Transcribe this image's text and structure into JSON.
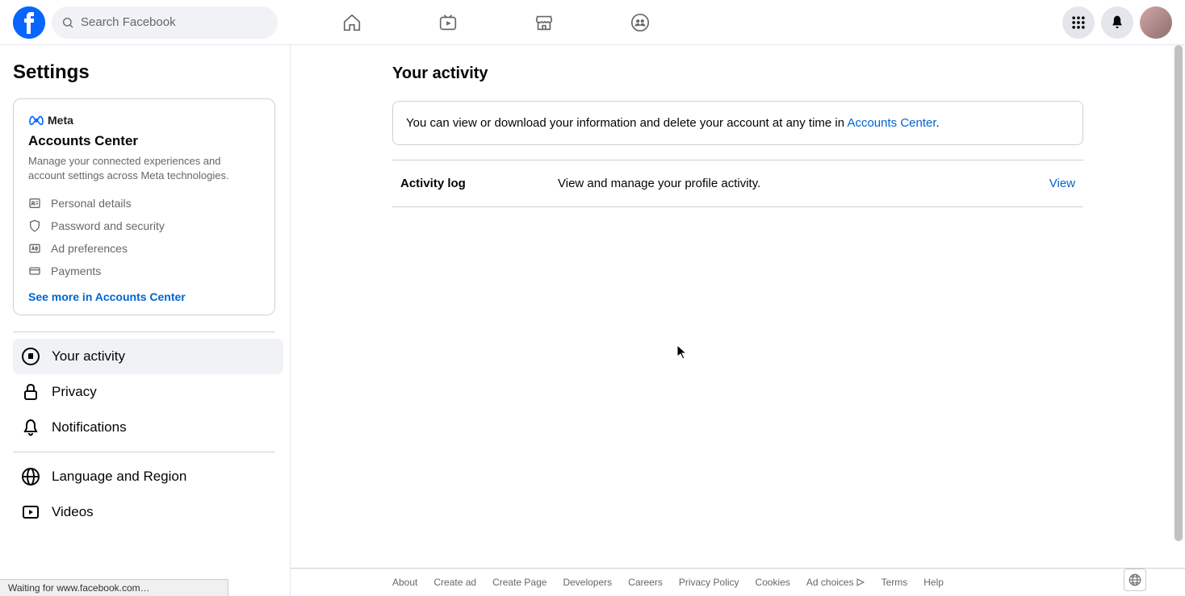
{
  "header": {
    "search_placeholder": "Search Facebook"
  },
  "sidebar": {
    "title": "Settings",
    "accounts_center": {
      "meta_label": "Meta",
      "title": "Accounts Center",
      "description": "Manage your connected experiences and account settings across Meta technologies.",
      "items": [
        {
          "label": "Personal details"
        },
        {
          "label": "Password and security"
        },
        {
          "label": "Ad preferences"
        },
        {
          "label": "Payments"
        }
      ],
      "see_more": "See more in Accounts Center"
    },
    "nav_primary": [
      {
        "label": "Your activity"
      },
      {
        "label": "Privacy"
      },
      {
        "label": "Notifications"
      }
    ],
    "nav_secondary": [
      {
        "label": "Language and Region"
      },
      {
        "label": "Videos"
      }
    ]
  },
  "content": {
    "heading": "Your activity",
    "info_prefix": "You can view or download your information and delete your account at any time in ",
    "info_link": "Accounts Center",
    "info_suffix": ".",
    "activity": {
      "title": "Activity log",
      "desc": "View and manage your profile activity.",
      "action": "View"
    }
  },
  "footer": {
    "links": [
      "About",
      "Create ad",
      "Create Page",
      "Developers",
      "Careers",
      "Privacy Policy",
      "Cookies"
    ],
    "ad_choices": "Ad choices",
    "links2": [
      "Terms",
      "Help"
    ]
  },
  "status_bar": "Waiting for www.facebook.com…"
}
